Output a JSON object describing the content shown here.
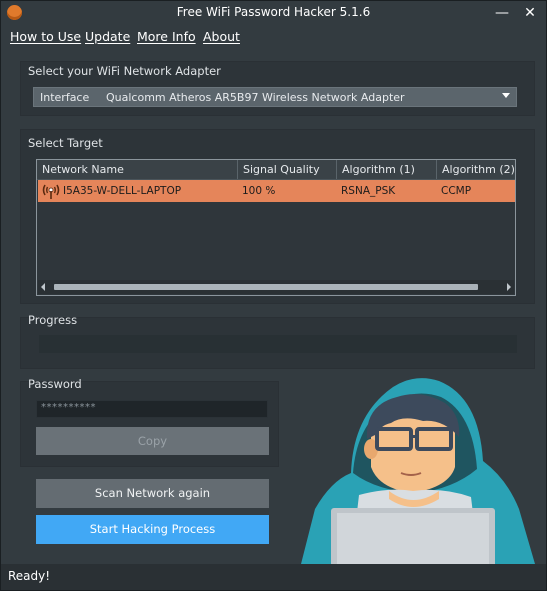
{
  "window": {
    "title": "Free WiFi Password Hacker 5.1.6",
    "minimize_glyph": "—",
    "close_glyph": "✕"
  },
  "menu": [
    {
      "label": "How to Use"
    },
    {
      "label": "Update"
    },
    {
      "label": "More Info"
    },
    {
      "label": "About"
    }
  ],
  "adapter": {
    "group_label": "Select your WiFi Network Adapter",
    "field_label": "Interface",
    "selected": "Qualcomm Atheros AR5B97 Wireless Network Adapter"
  },
  "target": {
    "group_label": "Select Target",
    "columns": [
      "Network Name",
      "Signal Quality",
      "Algorithm (1)",
      "Algorithm (2)"
    ],
    "rows": [
      {
        "icon": "wifi-signal-icon",
        "name": "I5A35-W-DELL-LAPTOP",
        "signal": "100 %",
        "alg1": "RSNA_PSK",
        "alg2": "CCMP"
      }
    ]
  },
  "progress": {
    "label": "Progress",
    "value": 0
  },
  "password": {
    "label": "Password",
    "value": "**********",
    "copy_label": "Copy"
  },
  "actions": {
    "scan_label": "Scan Network again",
    "start_label": "Start Hacking Process"
  },
  "status": {
    "text": "Ready!"
  },
  "colors": {
    "background": "#333b40",
    "selected_row": "#e5855a",
    "accent_button": "#41a8f5",
    "hood": "#2aa2b5",
    "app_icon": "#e07a2c"
  }
}
